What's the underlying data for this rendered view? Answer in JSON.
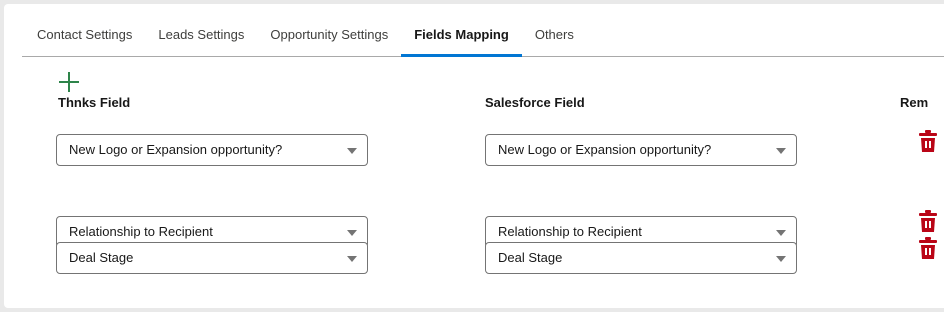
{
  "tabs": [
    {
      "label": "Contact Settings"
    },
    {
      "label": "Leads Settings"
    },
    {
      "label": "Opportunity Settings"
    },
    {
      "label": "Fields Mapping",
      "active": true
    },
    {
      "label": "Others"
    }
  ],
  "columns": {
    "thnks": "Thnks Field",
    "salesforce": "Salesforce Field",
    "remove": "Rem"
  },
  "rows": [
    {
      "thnks": "New Logo or Expansion opportunity?",
      "salesforce": "New Logo or Expansion opportunity?"
    },
    {
      "thnks": "Relationship to Recipient",
      "salesforce": "Relationship to Recipient"
    },
    {
      "thnks": "Deal Stage",
      "salesforce": "Deal Stage"
    }
  ],
  "colors": {
    "accent": "#0176d3",
    "add": "#2e844a",
    "delete": "#ba0517"
  },
  "icons": {
    "add": "plus-icon",
    "remove": "trash-icon",
    "dropdown": "chevron-down-icon"
  }
}
